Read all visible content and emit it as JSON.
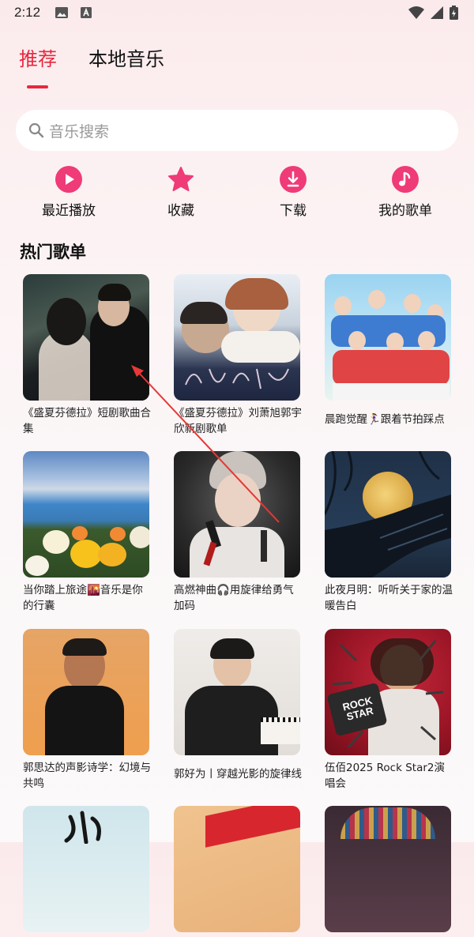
{
  "status_bar": {
    "time": "2:12"
  },
  "tabs": [
    {
      "label": "推荐"
    },
    {
      "label": "本地音乐"
    }
  ],
  "search": {
    "placeholder": "音乐搜索"
  },
  "shortcuts": [
    {
      "label": "最近播放",
      "icon": "play-icon"
    },
    {
      "label": "收藏",
      "icon": "star-icon"
    },
    {
      "label": "下载",
      "icon": "download-icon"
    },
    {
      "label": "我的歌单",
      "icon": "music-note-icon"
    }
  ],
  "section": {
    "title": "热门歌单"
  },
  "playlists": [
    {
      "caption": "《盛夏芬德拉》短剧歌曲合集"
    },
    {
      "caption": "《盛夏芬德拉》刘萧旭郭宇欣新剧歌单"
    },
    {
      "caption": "晨跑觉醒🏃‍♀️跟着节拍踩点"
    },
    {
      "caption": "当你踏上旅途🌇音乐是你的行囊"
    },
    {
      "caption": "高燃神曲🎧用旋律给勇气加码"
    },
    {
      "caption": "此夜月明：听听关于家的温暖告白"
    },
    {
      "caption": "郭思达的声影诗学：幻境与共鸣"
    },
    {
      "caption": "郭好为丨穿越光影的旋律线"
    },
    {
      "caption": "伍佰2025 Rock Star2演唱会"
    },
    {
      "caption": ""
    },
    {
      "caption": ""
    },
    {
      "caption": ""
    }
  ],
  "colors": {
    "accent": "#e8273e",
    "icon_pink": "#ef3b77"
  }
}
